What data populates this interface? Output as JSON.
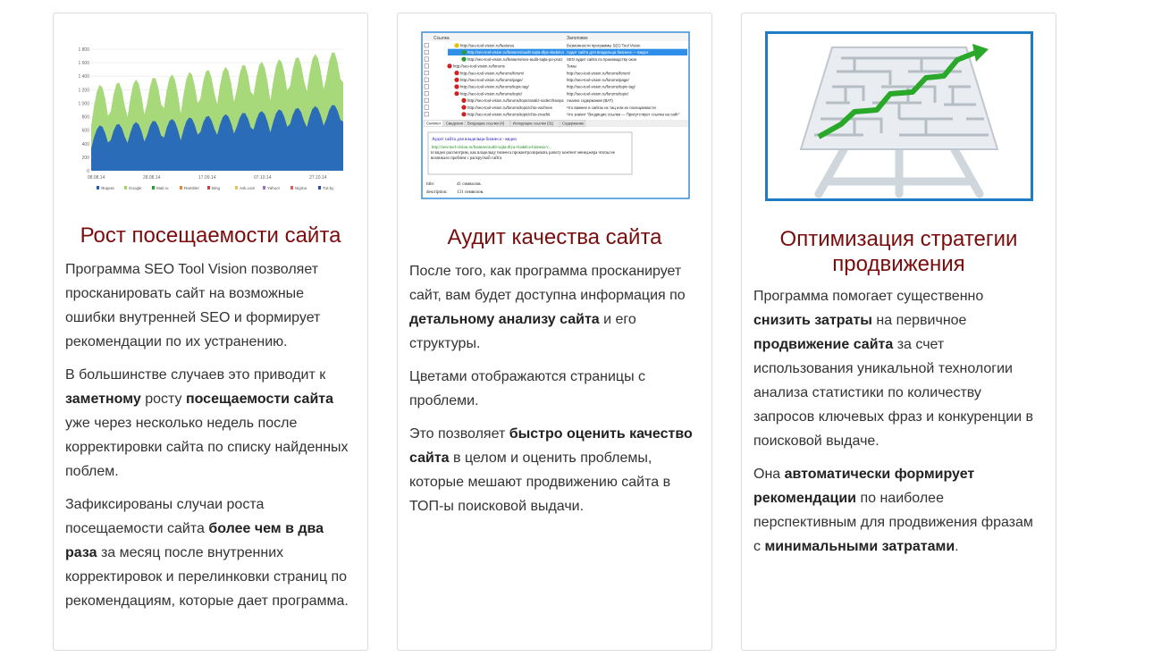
{
  "cards": [
    {
      "title": "Рост посещаемости сайта",
      "paragraphs": [
        [
          {
            "t": "Программа SEO Tool Vision позволяет просканировать сайт на возможные ошибки внутренней SEO и формирует рекомендации по их устранению."
          }
        ],
        [
          {
            "t": "В большинстве случаев это приводит к "
          },
          {
            "t": "заметному",
            "b": true
          },
          {
            "t": " росту "
          },
          {
            "t": "посещаемости сайта",
            "b": true
          },
          {
            "t": " уже через несколько недель после корректировки сайта по списку найденных поблем."
          }
        ],
        [
          {
            "t": "Зафиксированы случаи роста посещаемости сайта "
          },
          {
            "t": "более чем в два раза",
            "b": true
          },
          {
            "t": " за месяц после внутренних корректировок и перелинковки страниц по рекомендациям, которые дает программа."
          }
        ]
      ],
      "chart": {
        "yticks": [
          "1 800",
          "1 600",
          "1 400",
          "1 200",
          "1 000",
          "800",
          "600",
          "400",
          "200",
          "0"
        ],
        "xticks": [
          "08.08.14",
          "28.08.14",
          "17.09.14",
          "07.10.14",
          "27.10.14"
        ],
        "legend": [
          {
            "name": "Яндекс",
            "color": "#1f5fb0"
          },
          {
            "name": "Google",
            "color": "#9fd36b"
          },
          {
            "name": "Mail.ru",
            "color": "#2a9a3a"
          },
          {
            "name": "Rambler",
            "color": "#e08a3a"
          },
          {
            "name": "Bing",
            "color": "#d04040"
          },
          {
            "name": "Ask.com",
            "color": "#f0c060"
          },
          {
            "name": "Yahoo!",
            "color": "#a070c0"
          },
          {
            "name": "Nigma",
            "color": "#e06060"
          },
          {
            "name": "Tut.by",
            "color": "#3050a0"
          }
        ]
      }
    },
    {
      "title": "Аудит качества сайта",
      "paragraphs": [
        [
          {
            "t": "После того, как программа просканирует сайт, вам будет доступна информация по "
          },
          {
            "t": "детальному анализу сайта",
            "b": true
          },
          {
            "t": " и его структуры."
          }
        ],
        [
          {
            "t": "Цветами отображаются страницы с проблеми."
          }
        ],
        [
          {
            "t": "Это позволяет "
          },
          {
            "t": "быстро оценить качество сайта",
            "b": true
          },
          {
            "t": " в целом и оценить проблемы, которые мешают продвижению сайта в ТОП-ы поисковой выдачи."
          }
        ]
      ],
      "screenshot": {
        "col1": "Ссылка",
        "col2": "Заголовок",
        "rows": [
          {
            "url": "http://seo-tool-vision.ru/features",
            "title": "Возможности программы SEO Tool Vision",
            "ind": 1,
            "st": "y"
          },
          {
            "url": "http://seo-tool-vision.ru/features/audit-sajta-dlya-vladelca",
            "title": "Аудит сайта для владельца бизнеса — видео",
            "ind": 2,
            "st": "g",
            "sel": true
          },
          {
            "url": "http://seo-tool-vision.ru/features/seo-audit-sajta-po-proiz",
            "title": "SEO аудит сайта по производству окон",
            "ind": 2,
            "st": "g"
          },
          {
            "url": "http://seo-tool-vision.ru/forums",
            "title": "Темы",
            "ind": 0,
            "st": "r"
          },
          {
            "url": "http://seo-tool-vision.ru/forums/forum/",
            "title": "http://seo-tool-vision.ru/forums/forum/",
            "ind": 1,
            "st": "r"
          },
          {
            "url": "http://seo-tool-vision.ru/forums/page/",
            "title": "http://seo-tool-vision.ru/forums/page/",
            "ind": 1,
            "st": "r"
          },
          {
            "url": "http://seo-tool-vision.ru/forums/topic-tag/",
            "title": "http://seo-tool-vision.ru/forums/topic-tag/",
            "ind": 1,
            "st": "r"
          },
          {
            "url": "http://seo-tool-vision.ru/forums/topic/",
            "title": "http://seo-tool-vision.ru/forums/topic/",
            "ind": 1,
            "st": "r"
          },
          {
            "url": "http://seo-tool-vision.ru/forums/topic/analiz-soderzhaniya",
            "title": "Анализ содержания (ВАТ)",
            "ind": 2,
            "st": "r"
          },
          {
            "url": "http://seo-tool-vision.ru/forums/topic/chto-vazhnee",
            "title": "Что важнее в сайтах их тиц или их посещаемости",
            "ind": 2,
            "st": "r"
          },
          {
            "url": "http://seo-tool-vision.ru/forums/topic/chto-znachit",
            "title": "Что значит \"Входящие ссылки — Присутствует ссылка на сайт\"",
            "ind": 2,
            "st": "r"
          }
        ],
        "tabs": [
          "Сниппет",
          "Сведения",
          "Входящие ссылки (4)",
          "Исходящие ссылки (31)",
          "Содержание"
        ],
        "snippet": {
          "title": "Аудит сайта для владельца бизнеса - видео",
          "url": "http://seo-tool-vision.ru/features/audit-sajta-dlya-vladelca-biznesa-v...",
          "desc": "В видео рассмотрим, как владельцу бизнеса проконтролировать работу контент менеджера чтобы не возникало проблем с раскруткой сайта"
        },
        "stats": [
          {
            "label": "title:",
            "value": "41 символов."
          },
          {
            "label": "description:",
            "value": "131 символов."
          }
        ]
      }
    },
    {
      "title": "Оптимизация стратегии продвижения",
      "paragraphs": [
        [
          {
            "t": "Программа помогает существенно "
          },
          {
            "t": "снизить затраты",
            "b": true
          },
          {
            "t": " на первичное "
          },
          {
            "t": "продвижение сайта",
            "b": true
          },
          {
            "t": " за счет использования уникальной технологии анализа статистики по количеству запросов ключевых фраз и конкуренции в поисковой выдаче."
          }
        ],
        [
          {
            "t": "Она "
          },
          {
            "t": "автоматически формирует рекомендации",
            "b": true
          },
          {
            "t": " по наиболее перспективным для продвижения фразам с "
          },
          {
            "t": "минимальными затратами",
            "b": true
          },
          {
            "t": "."
          }
        ]
      ]
    }
  ],
  "colors": {
    "heading": "#7a0c0c",
    "text": "#333333",
    "border": "#dcdcdc",
    "frame": "#1e7bc4",
    "arrow": "#2aa82a"
  }
}
